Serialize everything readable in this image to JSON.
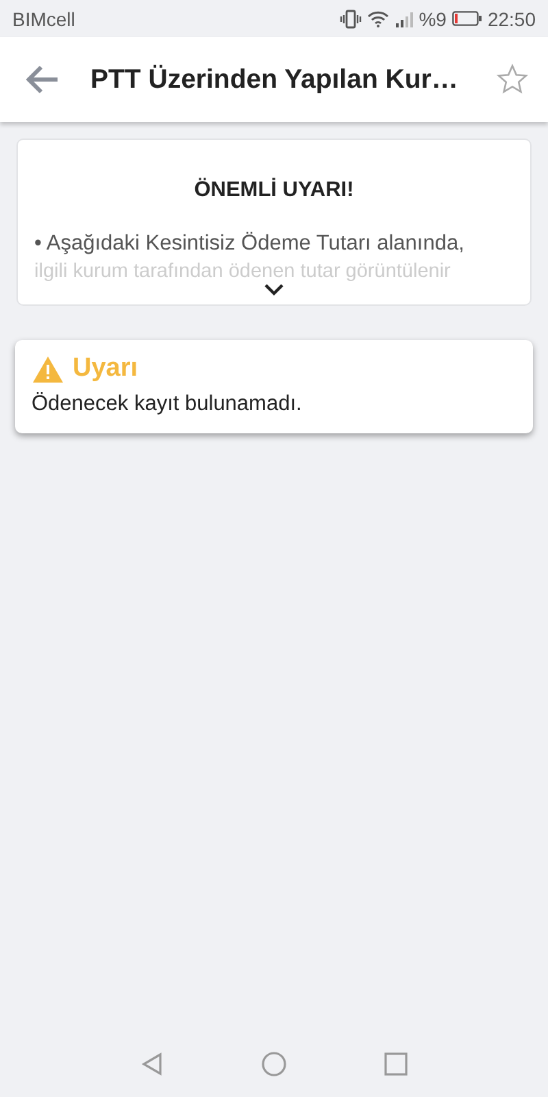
{
  "status_bar": {
    "carrier": "BIMcell",
    "battery": "%9",
    "time": "22:50"
  },
  "app_bar": {
    "title": "PTT Üzerinden Yapılan Kur…",
    "favorite": false
  },
  "notice": {
    "title": "ÖNEMLİ UYARI!",
    "lines": [
      "• Aşağıdaki Kesintisiz Ödeme Tutarı alanında,",
      "ilgili kurum tarafından ödenen tutar görüntülenir"
    ],
    "expanded": false
  },
  "alert": {
    "title": "Uyarı",
    "message": "Ödenecek kayıt bulunamadı."
  }
}
